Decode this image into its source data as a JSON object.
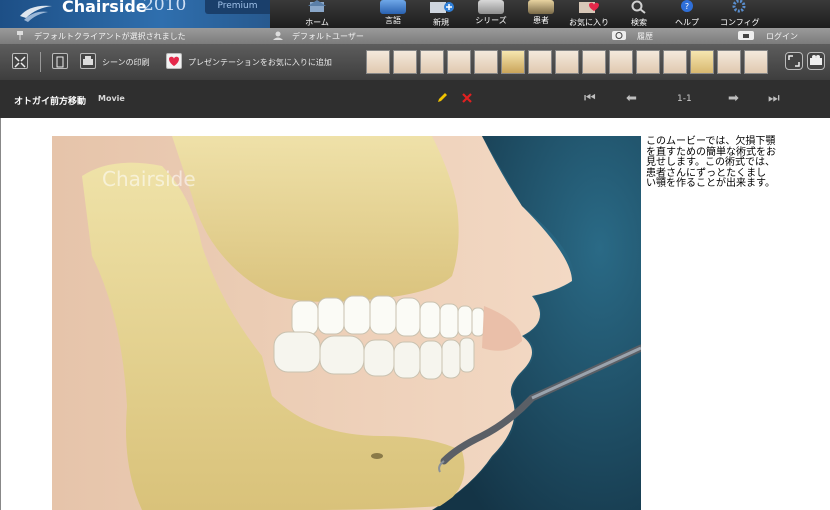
{
  "app": {
    "name": "Chairside",
    "year": "2010",
    "edition": "Premium"
  },
  "nav": [
    {
      "label": "ホーム",
      "icon": "home-icon"
    },
    {
      "label": "言語",
      "icon": "language-icon"
    },
    {
      "label": "新規",
      "icon": "new-icon"
    },
    {
      "label": "シリーズ",
      "icon": "series-icon"
    },
    {
      "label": "患者",
      "icon": "patient-icon"
    },
    {
      "label": "お気に入り",
      "icon": "favorites-icon"
    },
    {
      "label": "検索",
      "icon": "search-icon"
    },
    {
      "label": "ヘルプ",
      "icon": "help-icon"
    },
    {
      "label": "コンフィグ",
      "icon": "config-icon"
    }
  ],
  "status": {
    "client": "デフォルトクライアントが選択されました",
    "user": "デフォルトユーザー",
    "history": "履歴",
    "login": "ログイン"
  },
  "toolbar": {
    "print_label": "シーンの印刷",
    "add_favorite_label": "プレゼンテーションをお気に入りに追加"
  },
  "scene": {
    "title": "オトガイ前方移動",
    "type": "Movie",
    "page": "1-1"
  },
  "caption": "このムービーでは、欠損下顎を直すための簡単な術式をお見せします。この術式では、患者さんにずっとたくましい顎を作ることが出来ます。",
  "watermark": "Chairside",
  "colors": {
    "brand": "#2f6fae",
    "toolbar": "#4a4a4a",
    "titlebar": "#2f2f2f",
    "edit": "#f2c400",
    "delete": "#e02020",
    "ocean": "#1f4a63"
  }
}
